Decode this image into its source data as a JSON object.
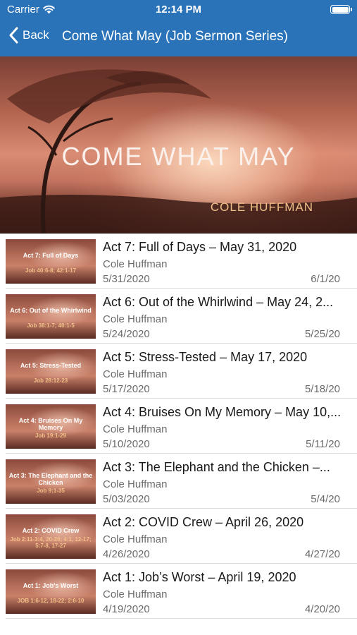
{
  "status_bar": {
    "carrier": "Carrier",
    "time": "12:14 PM"
  },
  "nav": {
    "back_label": "Back",
    "title": "Come What May (Job Sermon Series)"
  },
  "hero": {
    "title": "COME WHAT MAY",
    "author": "COLE HUFFMAN"
  },
  "colors": {
    "nav_bar": "#2a73b8",
    "separator": "#dcdcdc",
    "hero_author": "#f0c089"
  },
  "sermons": [
    {
      "thumb_title": "Act 7: Full of Days",
      "thumb_ref": "Job 40:6-8; 42:1-17",
      "title": "Act 7: Full of Days – May 31, 2020",
      "author": "Cole Huffman",
      "date": "5/31/2020",
      "posted": "6/1/20"
    },
    {
      "thumb_title": "Act 6: Out of the Whirlwind",
      "thumb_ref": "Job 38:1-7; 40:1-5",
      "title": "Act 6: Out of the Whirlwind – May 24, 2...",
      "author": "Cole Huffman",
      "date": "5/24/2020",
      "posted": "5/25/20"
    },
    {
      "thumb_title": "Act 5: Stress-Tested",
      "thumb_ref": "Job 28:12-23",
      "title": "Act 5: Stress-Tested – May 17, 2020",
      "author": "Cole Huffman",
      "date": "5/17/2020",
      "posted": "5/18/20"
    },
    {
      "thumb_title": "Act 4: Bruises On My Memory",
      "thumb_ref": "Job 19:1-29",
      "title": "Act 4: Bruises On My Memory – May 10,...",
      "author": "Cole Huffman",
      "date": "5/10/2020",
      "posted": "5/11/20"
    },
    {
      "thumb_title": "Act 3: The Elephant and the Chicken",
      "thumb_ref": "Job 9:1-35",
      "title": "Act 3: The Elephant and the Chicken –...",
      "author": "Cole Huffman",
      "date": "5/03/2020",
      "posted": "5/4/20"
    },
    {
      "thumb_title": "Act 2: COVID Crew",
      "thumb_ref": "Job 2:11-3:4, 20-26; 4:1, 12-17; 5:7-8, 17-27",
      "title": "Act 2: COVID Crew – April 26, 2020",
      "author": "Cole Huffman",
      "date": "4/26/2020",
      "posted": "4/27/20"
    },
    {
      "thumb_title": "Act 1: Job's Worst",
      "thumb_ref": "JOB 1:6-12, 18-22; 2:6-10",
      "title": "Act 1: Job’s Worst – April 19, 2020",
      "author": "Cole Huffman",
      "date": "4/19/2020",
      "posted": "4/20/20"
    }
  ]
}
